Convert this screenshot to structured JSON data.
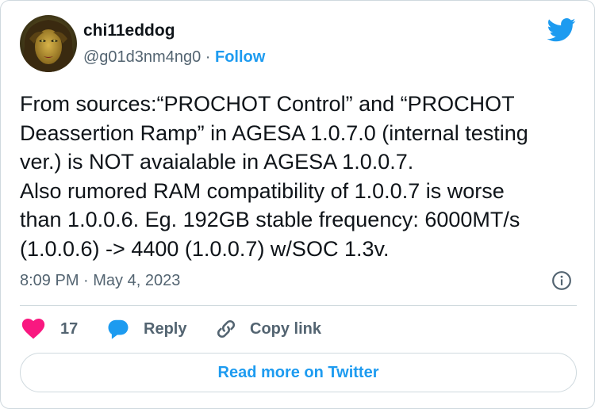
{
  "author": {
    "display_name": "chi11eddog",
    "handle": "@g01d3nm4ng0",
    "separator": "·",
    "follow_label": "Follow"
  },
  "tweet": {
    "lines": [
      "From sources:“PROCHOT Control” and “PROCHOT",
      "Deassertion Ramp” in AGESA 1.0.7.0 (internal testing",
      "ver.) is NOT avaialable in AGESA 1.0.0.7.",
      "Also rumored RAM compatibility of 1.0.0.7 is worse",
      "than 1.0.0.6. Eg. 192GB stable frequency: 6000MT/s",
      "(1.0.0.6) -> 4400 (1.0.0.7) w/SOC 1.3v."
    ],
    "timestamp": "8:09 PM · May 4, 2023"
  },
  "actions": {
    "like_count": "17",
    "reply_label": "Reply",
    "copy_link_label": "Copy link"
  },
  "read_more_label": "Read more on Twitter",
  "colors": {
    "brand_blue": "#1d9bf0",
    "like_red": "#f91880",
    "text_primary": "#0f1419",
    "text_secondary": "#536471",
    "border": "#cfd9de"
  },
  "icons": {
    "brand": "twitter-bird-icon",
    "info": "info-icon",
    "like": "heart-icon",
    "reply": "speech-bubble-icon",
    "copy": "link-icon"
  }
}
